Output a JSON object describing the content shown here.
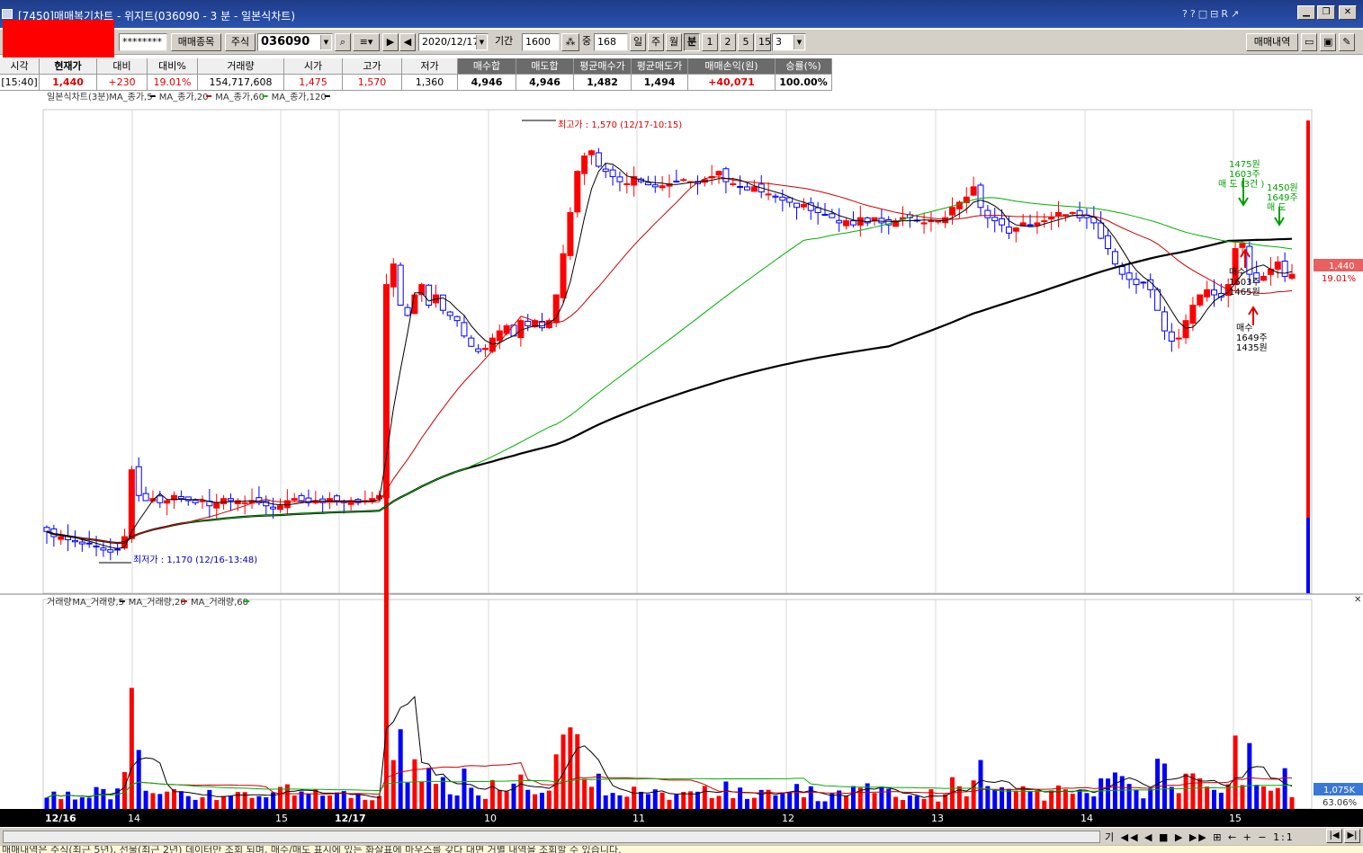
{
  "window": {
    "title": "[7450]매매복기차트 - 위지트(036090 - 3 분 - 일본식차트)",
    "tool_icons": [
      "?",
      "?",
      "□",
      "⊟",
      "R",
      "↗"
    ],
    "minimize": "▁",
    "restore": "❐",
    "close": "✕"
  },
  "toolbar": {
    "masked_account": "********",
    "trade_item_button": "매매종목",
    "market_label": "주식",
    "stock_code": "036090",
    "date": "2020/12/17",
    "period_label": "기간",
    "period_value": "1600",
    "count_label": "중",
    "count_value": "168",
    "intervals": [
      "일",
      "주",
      "월",
      "분",
      "1",
      "2",
      "5",
      "15"
    ],
    "interval_active": "분",
    "minute_value": "3",
    "history_button": "매매내역"
  },
  "quote": {
    "headers": [
      "시각",
      "현재가",
      "대비",
      "대비%",
      "거래량",
      "시가",
      "고가",
      "저가",
      "매수합",
      "매도합",
      "평균매수가",
      "평균매도가",
      "매매손익(원)",
      "승률(%)"
    ],
    "values": [
      "[15:40]",
      "1,440",
      "+230",
      "19.01%",
      "154,717,608",
      "1,475",
      "1,570",
      "1,360",
      "4,946",
      "4,946",
      "1,482",
      "1,494",
      "+40,071",
      "100.00%"
    ]
  },
  "colors": {
    "up": "#ff0000",
    "down": "#0000ff",
    "ma5": "#000000",
    "ma20": "#cc0000",
    "ma60": "#00b000",
    "ma120": "#000000"
  },
  "chart_data": [
    {
      "type": "candlestick",
      "legend": [
        "일본식차트(3분)",
        "MA_종가,5",
        "MA_종가,20",
        "MA_종가,60",
        "MA_종가,120"
      ],
      "x_tick_labels": [
        "12/16",
        "14",
        "15",
        "12/17",
        "10",
        "11",
        "12",
        "13",
        "14",
        "15"
      ],
      "high_label": "최고가 : 1,570 (12/17-10:15)",
      "low_label": "최저가 : 1,170 (12/16-13:48)",
      "price_tag": "1,440",
      "change_tag": "19.01%",
      "annotations": {
        "sell1": [
          "1475원",
          "1603주",
          "매 도 (3건 )"
        ],
        "sell2": [
          "1450원",
          "1649주",
          "매 도"
        ],
        "buy1": [
          "매수",
          "1603주",
          "1465원"
        ],
        "buy2": [
          "매수",
          "1649주",
          "1435원"
        ]
      },
      "ylim": [
        1130,
        1600
      ],
      "close_prices": [
        1190,
        1185,
        1185,
        1182,
        1180,
        1178,
        1178,
        1175,
        1172,
        1170,
        1172,
        1185,
        1250,
        1225,
        1220,
        1222,
        1218,
        1220,
        1225,
        1222,
        1220,
        1218,
        1220,
        1215,
        1218,
        1222,
        1220,
        1220,
        1218,
        1220,
        1218,
        1215,
        1212,
        1215,
        1220,
        1222,
        1220,
        1218,
        1220,
        1218,
        1222,
        1220,
        1218,
        1220,
        1218,
        1220,
        1222,
        1225,
        1430,
        1450,
        1410,
        1400,
        1420,
        1430,
        1410,
        1420,
        1405,
        1400,
        1395,
        1380,
        1370,
        1365,
        1368,
        1378,
        1385,
        1390,
        1380,
        1395,
        1390,
        1395,
        1388,
        1395,
        1420,
        1460,
        1500,
        1540,
        1555,
        1560,
        1545,
        1540,
        1535,
        1530,
        1528,
        1535,
        1530,
        1527,
        1525,
        1526,
        1528,
        1530,
        1532,
        1530,
        1528,
        1532,
        1535,
        1540,
        1530,
        1528,
        1525,
        1522,
        1525,
        1520,
        1518,
        1515,
        1512,
        1510,
        1505,
        1508,
        1502,
        1500,
        1498,
        1495,
        1490,
        1492,
        1488,
        1495,
        1490,
        1495,
        1490,
        1488,
        1492,
        1495,
        1495,
        1492,
        1490,
        1492,
        1492,
        1495,
        1505,
        1510,
        1515,
        1525,
        1505,
        1495,
        1492,
        1488,
        1480,
        1485,
        1490,
        1488,
        1490,
        1492,
        1495,
        1500,
        1498,
        1500,
        1495,
        1495,
        1490,
        1475,
        1465,
        1450,
        1440,
        1435,
        1430,
        1432,
        1425,
        1405,
        1385,
        1375,
        1378,
        1395,
        1410,
        1420,
        1425,
        1420,
        1418,
        1430,
        1465,
        1470,
        1440,
        1432,
        1438,
        1445,
        1452,
        1438,
        1440
      ]
    },
    {
      "type": "bar",
      "legend": [
        "거래량",
        "MA_거래량,5",
        "MA_거래량,20",
        "MA_거래량,60"
      ],
      "volume_tag": "1,075K",
      "ratio_tag": "63.06%",
      "ylim": [
        0,
        2200
      ]
    }
  ],
  "statusbar": {
    "controls": "기 ◀◀ ◀ ■ ▶ ▶▶ ⊞ ← + − 1:1",
    "nav_buttons": [
      "|◀",
      "▶|"
    ]
  },
  "infobar": {
    "text": "매매내역은 주식(최근 5년), 선물(최근 2년) 데이터만 조회 되며, 매수/매도 표시에 있는 화살표에 마우스를 갖다 대면 거별 내역을 조회할 수 있습니다."
  }
}
